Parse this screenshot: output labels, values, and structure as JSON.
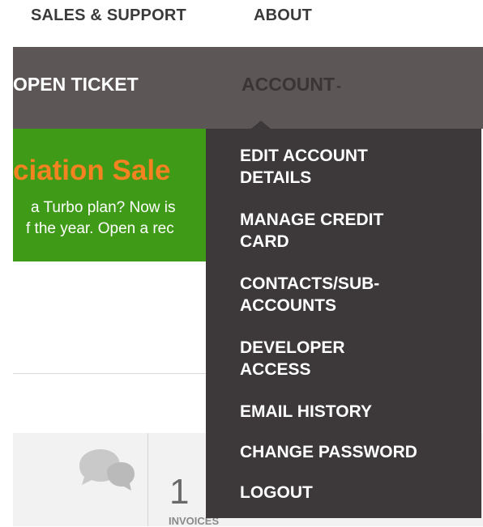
{
  "topnav": {
    "sales_support": "SALES & SUPPORT",
    "about": "ABOUT"
  },
  "subnav": {
    "open_ticket": "OPEN TICKET",
    "account": "ACCOUNT",
    "account_caret": "-"
  },
  "banner": {
    "title": "ciation Sale",
    "line1": "a Turbo plan? Now is",
    "line2": "f the year. Open a rec"
  },
  "account_menu": {
    "items": [
      {
        "label_line1": "EDIT ACCOUNT",
        "label_line2": "DETAILS"
      },
      {
        "label_line1": "MANAGE CREDIT",
        "label_line2": "CARD"
      },
      {
        "label_line1": "CONTACTS/SUB-",
        "label_line2": "ACCOUNTS"
      },
      {
        "label_line1": "DEVELOPER",
        "label_line2": "ACCESS"
      },
      {
        "label_line1": "EMAIL HISTORY"
      },
      {
        "label_line1": "CHANGE PASSWORD"
      },
      {
        "label_line1": "LOGOUT"
      }
    ]
  },
  "stats": {
    "icon": "chat-bubbles-icon",
    "invoices_count": "1",
    "invoices_label": "INVOICES"
  },
  "colors": {
    "subnav_bg": "#5c5756",
    "menu_bg": "#3d3839",
    "banner_green": "#3f9b17",
    "banner_orange": "#f58220"
  }
}
